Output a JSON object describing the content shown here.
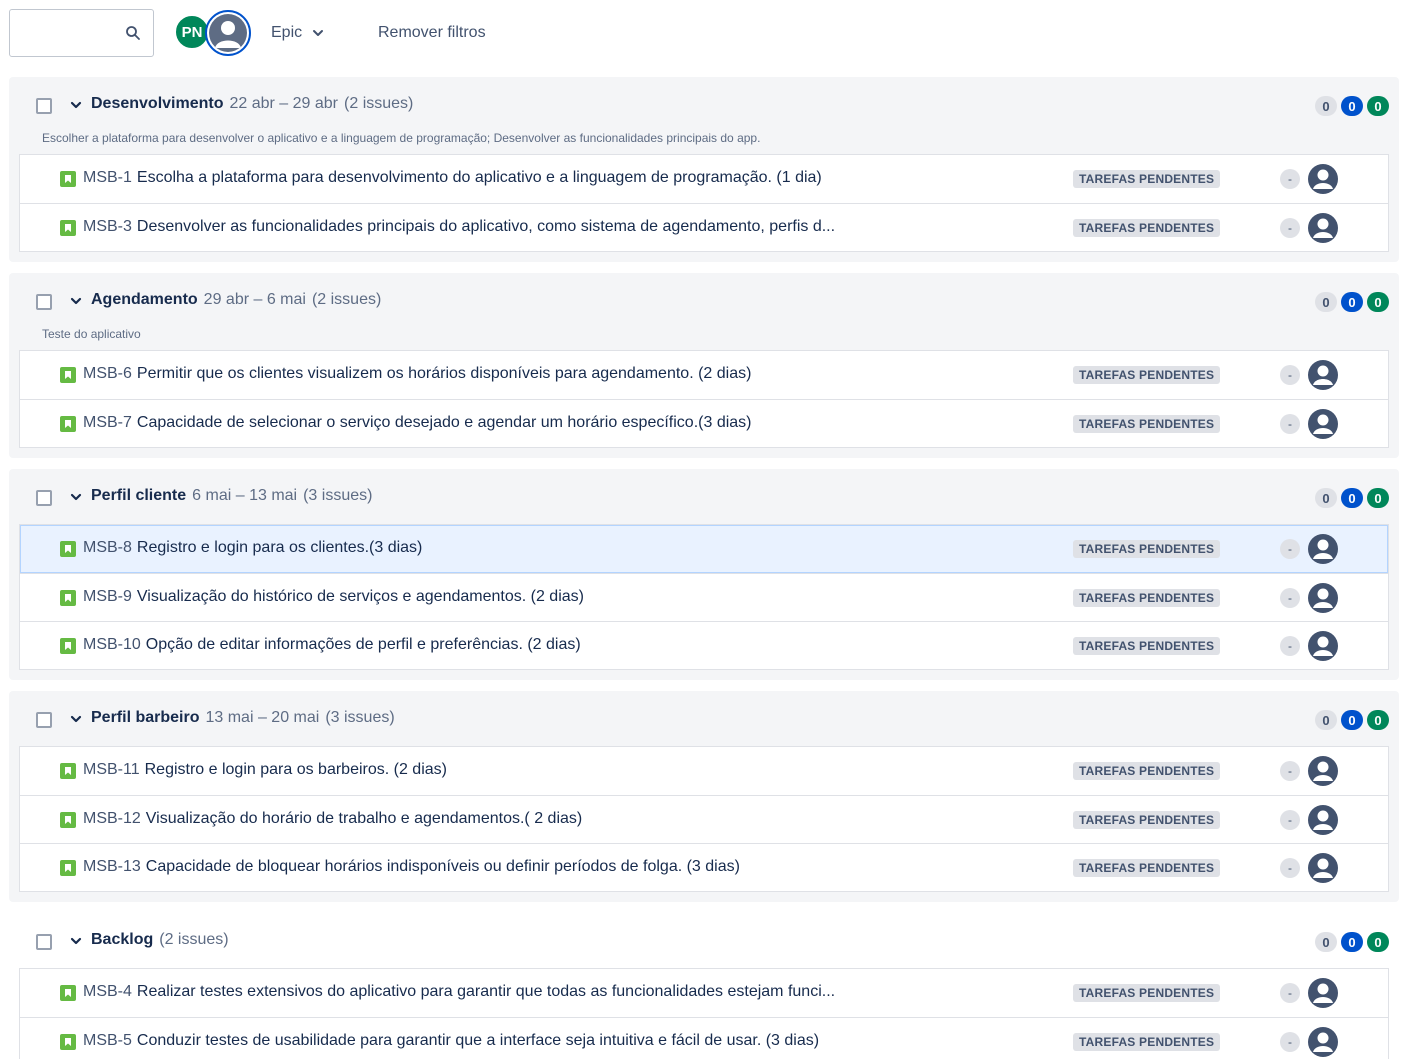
{
  "toolbar": {
    "search_placeholder": "",
    "avatar_initials": "PN",
    "epic_label": "Epic",
    "remove_filters_label": "Remover filtros"
  },
  "sprints": [
    {
      "name": "Desenvolvimento",
      "dates": "22 abr – 29 abr",
      "count": "(2 issues)",
      "description": "Escolher a plataforma para desenvolver o aplicativo e a linguagem de programação; Desenvolver as funcionalidades principais do app.",
      "counts": [
        "0",
        "0",
        "0"
      ],
      "issues": [
        {
          "key": "MSB-1",
          "summary": "Escolha a plataforma para desenvolvimento do aplicativo e a linguagem de programação. (1 dia)",
          "status": "TAREFAS PENDENTES",
          "estimate": "-"
        },
        {
          "key": "MSB-3",
          "summary": "Desenvolver as funcionalidades principais do aplicativo, como sistema de agendamento, perfis d...",
          "status": "TAREFAS PENDENTES",
          "estimate": "-"
        }
      ]
    },
    {
      "name": "Agendamento",
      "dates": "29 abr – 6 mai",
      "count": "(2 issues)",
      "description": "Teste do aplicativo",
      "counts": [
        "0",
        "0",
        "0"
      ],
      "issues": [
        {
          "key": "MSB-6",
          "summary": "Permitir que os clientes visualizem os horários disponíveis para agendamento. (2 dias)",
          "status": "TAREFAS PENDENTES",
          "estimate": "-"
        },
        {
          "key": "MSB-7",
          "summary": "Capacidade de selecionar o serviço desejado e agendar um horário específico.(3 dias)",
          "status": "TAREFAS PENDENTES",
          "estimate": "-"
        }
      ]
    },
    {
      "name": "Perfil cliente",
      "dates": "6 mai – 13 mai",
      "count": "(3 issues)",
      "description": "",
      "counts": [
        "0",
        "0",
        "0"
      ],
      "issues": [
        {
          "key": "MSB-8",
          "summary": "Registro e login para os clientes.(3 dias)",
          "status": "TAREFAS PENDENTES",
          "estimate": "-"
        },
        {
          "key": "MSB-9",
          "summary": "Visualização do histórico de serviços e agendamentos. (2 dias)",
          "status": "TAREFAS PENDENTES",
          "estimate": "-"
        },
        {
          "key": "MSB-10",
          "summary": "Opção de editar informações de perfil e preferências. (2 dias)",
          "status": "TAREFAS PENDENTES",
          "estimate": "-"
        }
      ]
    },
    {
      "name": "Perfil barbeiro",
      "dates": "13 mai – 20 mai",
      "count": "(3 issues)",
      "description": "",
      "counts": [
        "0",
        "0",
        "0"
      ],
      "issues": [
        {
          "key": "MSB-11",
          "summary": "Registro e login para os barbeiros. (2 dias)",
          "status": "TAREFAS PENDENTES",
          "estimate": "-"
        },
        {
          "key": "MSB-12",
          "summary": "Visualização do horário de trabalho e agendamentos.( 2 dias)",
          "status": "TAREFAS PENDENTES",
          "estimate": "-"
        },
        {
          "key": "MSB-13",
          "summary": "Capacidade de bloquear horários indisponíveis ou definir períodos de folga. (3 dias)",
          "status": "TAREFAS PENDENTES",
          "estimate": "-"
        }
      ]
    }
  ],
  "backlog": {
    "name": "Backlog",
    "count": "(2 issues)",
    "counts": [
      "0",
      "0",
      "0"
    ],
    "issues": [
      {
        "key": "MSB-4",
        "summary": "Realizar testes extensivos do aplicativo para garantir que todas as funcionalidades estejam funci...",
        "status": "TAREFAS PENDENTES",
        "estimate": "-"
      },
      {
        "key": "MSB-5",
        "summary": "Conduzir testes de usabilidade para garantir que a interface seja intuitiva e fácil de usar. (3 dias)",
        "status": "TAREFAS PENDENTES",
        "estimate": "-"
      }
    ]
  }
}
